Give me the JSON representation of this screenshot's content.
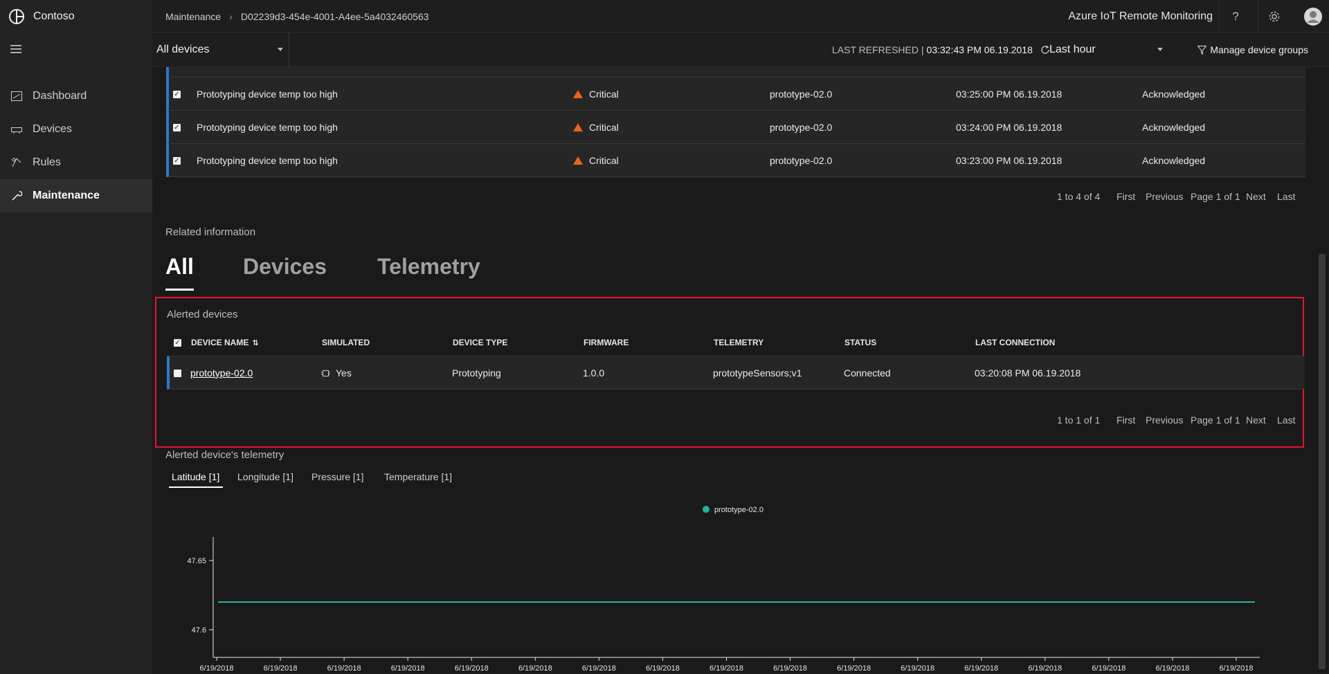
{
  "brand": {
    "name": "Contoso"
  },
  "sidebar": {
    "items": [
      {
        "label": "Dashboard",
        "icon": "dashboard-icon"
      },
      {
        "label": "Devices",
        "icon": "devices-icon"
      },
      {
        "label": "Rules",
        "icon": "rules-icon"
      },
      {
        "label": "Maintenance",
        "icon": "maintenance-icon",
        "active": true
      }
    ]
  },
  "header": {
    "breadcrumb": [
      "Maintenance",
      "D02239d3-454e-4001-A4ee-5a4032460563"
    ],
    "app_title": "Azure IoT Remote Monitoring"
  },
  "toolbar": {
    "device_group": "All devices",
    "last_refreshed_label": "LAST REFRESHED |",
    "last_refreshed_value": "03:32:43 PM 06.19.2018",
    "time_range": "Last hour",
    "manage_groups": "Manage device groups"
  },
  "alerts": {
    "rows": [
      {
        "rule": "Prototyping device temp too high",
        "severity": "Critical",
        "device": "prototype-02.0",
        "time": "03:25:00 PM 06.19.2018",
        "status": "Acknowledged"
      },
      {
        "rule": "Prototyping device temp too high",
        "severity": "Critical",
        "device": "prototype-02.0",
        "time": "03:24:00 PM 06.19.2018",
        "status": "Acknowledged"
      },
      {
        "rule": "Prototyping device temp too high",
        "severity": "Critical",
        "device": "prototype-02.0",
        "time": "03:23:00 PM 06.19.2018",
        "status": "Acknowledged"
      }
    ],
    "pager": {
      "range": "1 to 4 of 4",
      "first": "First",
      "previous": "Previous",
      "page": "Page 1 of 1",
      "next": "Next",
      "last": "Last"
    }
  },
  "related": {
    "label": "Related information",
    "tabs": [
      "All",
      "Devices",
      "Telemetry"
    ]
  },
  "alerted_devices": {
    "title": "Alerted devices",
    "columns": [
      "DEVICE NAME",
      "SIMULATED",
      "DEVICE TYPE",
      "FIRMWARE",
      "TELEMETRY",
      "STATUS",
      "LAST CONNECTION"
    ],
    "row": {
      "name": "prototype-02.0",
      "simulated": "Yes",
      "type": "Prototyping",
      "firmware": "1.0.0",
      "telemetry": "prototypeSensors;v1",
      "status": "Connected",
      "last_connection": "03:20:08 PM 06.19.2018"
    },
    "pager": {
      "range": "1 to 1 of 1",
      "first": "First",
      "previous": "Previous",
      "page": "Page 1 of 1",
      "next": "Next",
      "last": "Last"
    }
  },
  "telemetry": {
    "title": "Alerted device's telemetry",
    "tabs": [
      "Latitude [1]",
      "Longitude [1]",
      "Pressure [1]",
      "Temperature [1]"
    ]
  },
  "chart_data": {
    "type": "line",
    "series": [
      {
        "name": "prototype-02.0",
        "color": "#1fb5a3",
        "values": [
          47.62,
          47.62
        ]
      }
    ],
    "y_ticks": [
      "47.65",
      "47.6"
    ],
    "ylim": [
      47.58,
      47.67
    ],
    "x_tick_labels": [
      "6/19/2018",
      "6/19/2018",
      "6/19/2018",
      "6/19/2018",
      "6/19/2018",
      "6/19/2018",
      "6/19/2018",
      "6/19/2018",
      "6/19/2018",
      "6/19/2018",
      "6/19/2018",
      "6/19/2018",
      "6/19/2018",
      "6/19/2018",
      "6/19/2018",
      "6/19/2018",
      "6/19/2018"
    ],
    "grid": false,
    "legend": "top-center"
  }
}
